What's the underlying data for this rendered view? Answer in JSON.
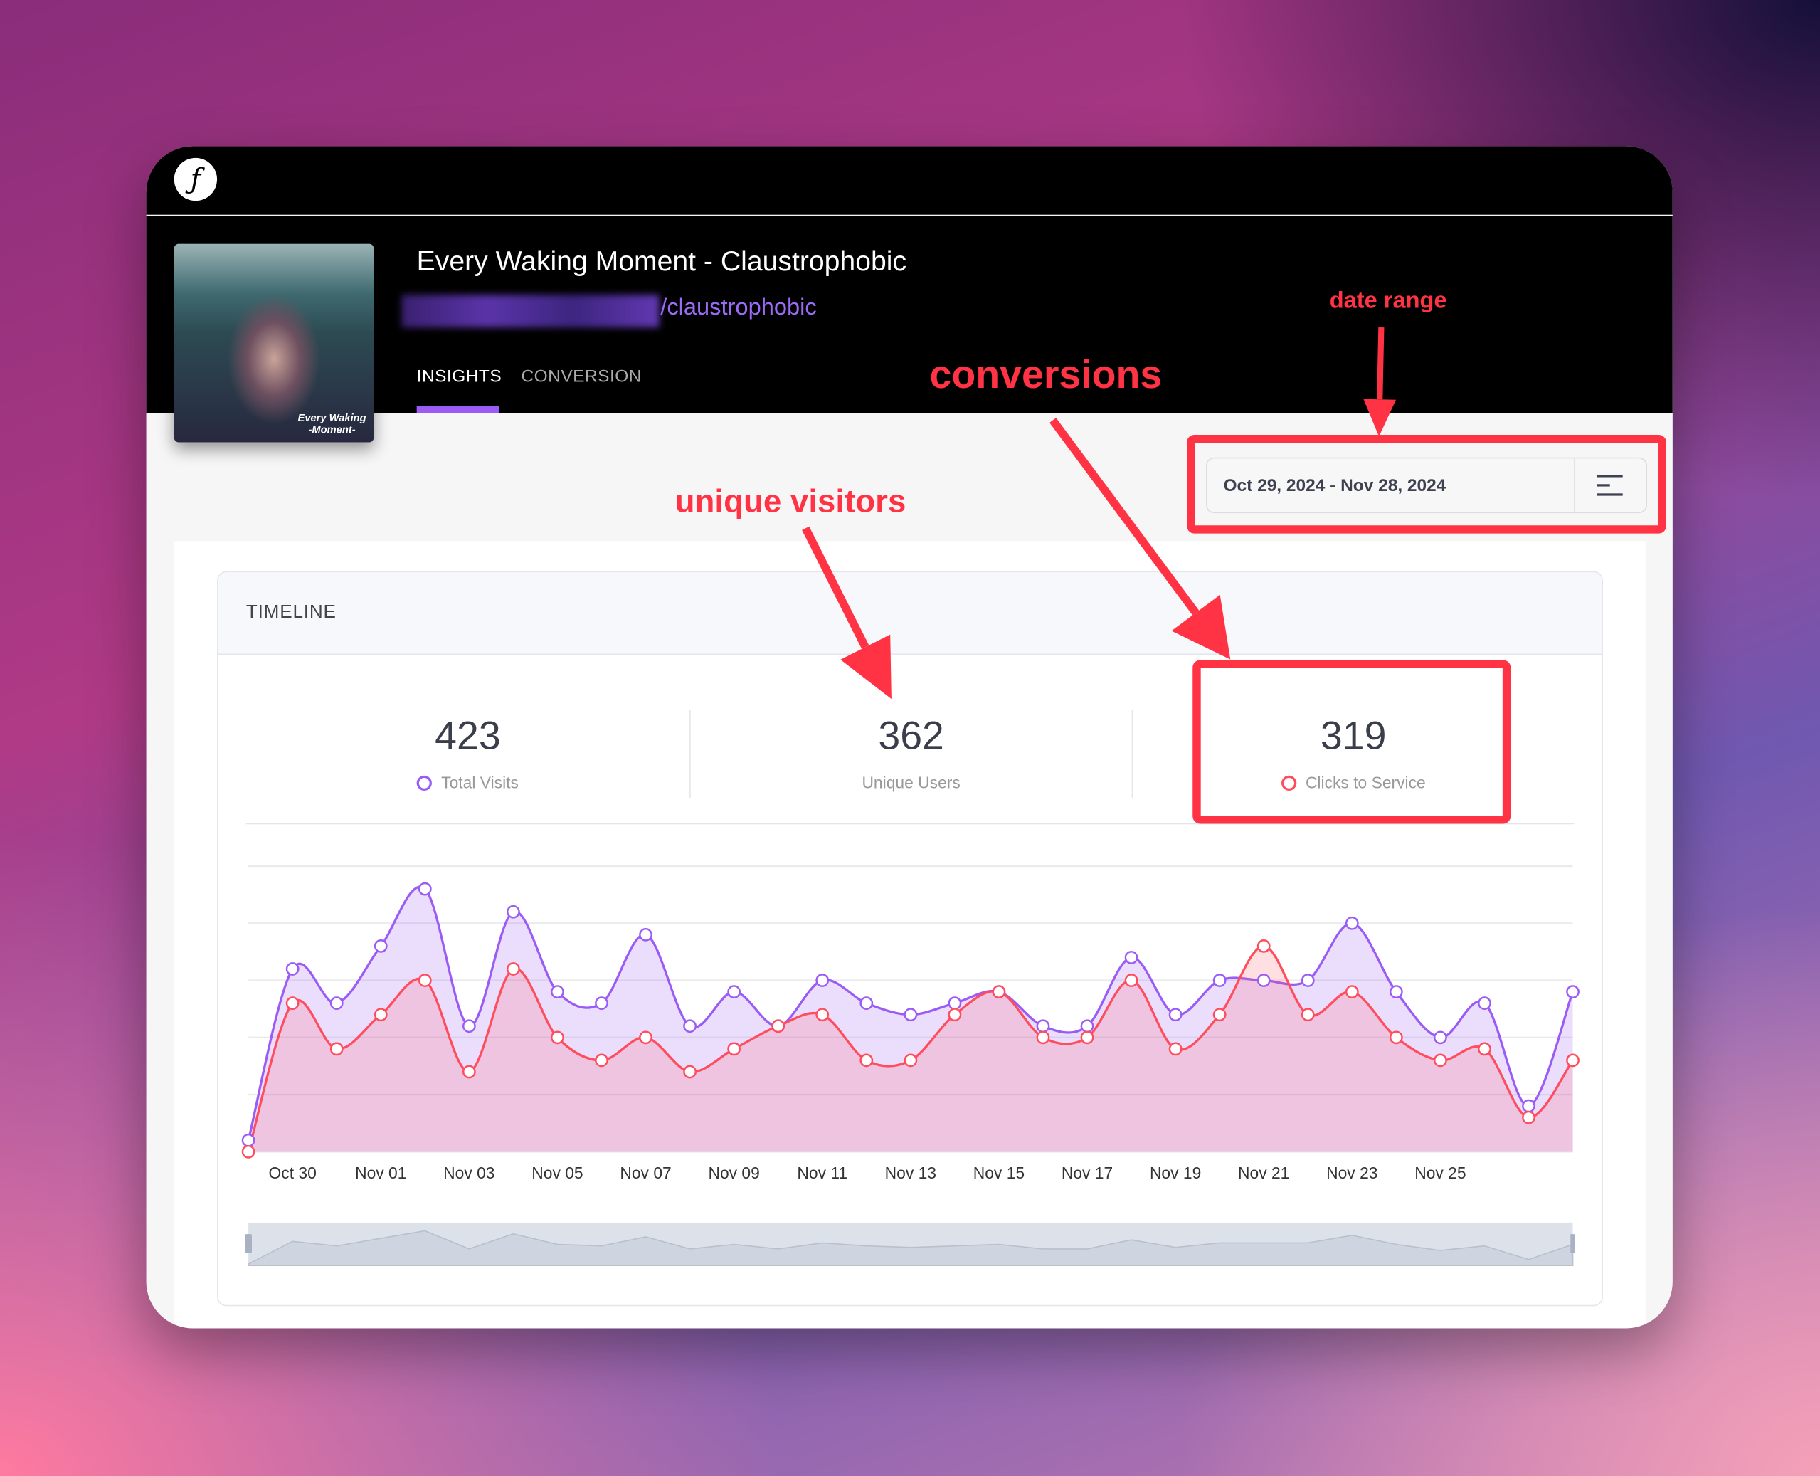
{
  "app": {
    "logo_icon": "f-link-logo"
  },
  "release": {
    "title": "Every Waking Moment - Claustrophobic",
    "slug": "/claustrophobic",
    "art_text": "Every Waking -Moment-"
  },
  "tabs": [
    {
      "label": "INSIGHTS",
      "active": true
    },
    {
      "label": "CONVERSION",
      "active": false
    }
  ],
  "date_range": {
    "value": "Oct 29, 2024 - Nov 28, 2024",
    "menu_icon": "menu-icon"
  },
  "timeline": {
    "title": "TIMELINE",
    "stats": [
      {
        "value": "423",
        "label": "Total Visits",
        "color": "#9b5cf6"
      },
      {
        "value": "362",
        "label": "Unique Users"
      },
      {
        "value": "319",
        "label": "Clicks to Service",
        "color": "#ff4d5e"
      }
    ]
  },
  "annotations": {
    "date_range": "date range",
    "conversions": "conversions",
    "unique_visitors": "unique visitors",
    "color": "#ff3344"
  },
  "chart_data": {
    "type": "area",
    "x": [
      "Oct 29",
      "Oct 30",
      "Oct 31",
      "Nov 01",
      "Nov 02",
      "Nov 03",
      "Nov 04",
      "Nov 05",
      "Nov 06",
      "Nov 07",
      "Nov 08",
      "Nov 09",
      "Nov 10",
      "Nov 11",
      "Nov 12",
      "Nov 13",
      "Nov 14",
      "Nov 15",
      "Nov 16",
      "Nov 17",
      "Nov 18",
      "Nov 19",
      "Nov 20",
      "Nov 21",
      "Nov 22",
      "Nov 23",
      "Nov 24",
      "Nov 25",
      "Nov 26",
      "Nov 27",
      "Nov 28"
    ],
    "tick_labels": [
      "Oct 30",
      "Nov 01",
      "Nov 03",
      "Nov 05",
      "Nov 07",
      "Nov 09",
      "Nov 11",
      "Nov 13",
      "Nov 15",
      "Nov 17",
      "Nov 19",
      "Nov 21",
      "Nov 23",
      "Nov 25"
    ],
    "ylim": [
      0,
      25
    ],
    "grid": true,
    "series": [
      {
        "name": "Total Visits",
        "color": "#9b5cf6",
        "values": [
          1,
          16,
          13,
          18,
          23,
          11,
          21,
          14,
          13,
          19,
          11,
          14,
          11,
          15,
          13,
          12,
          13,
          14,
          11,
          11,
          17,
          12,
          15,
          15,
          15,
          20,
          14,
          10,
          13,
          4,
          14
        ]
      },
      {
        "name": "Clicks to Service",
        "color": "#ff4d5e",
        "values": [
          0,
          13,
          9,
          12,
          15,
          7,
          16,
          10,
          8,
          10,
          7,
          9,
          11,
          12,
          8,
          8,
          12,
          14,
          10,
          10,
          15,
          9,
          12,
          18,
          12,
          14,
          10,
          8,
          9,
          3,
          8
        ]
      }
    ]
  }
}
